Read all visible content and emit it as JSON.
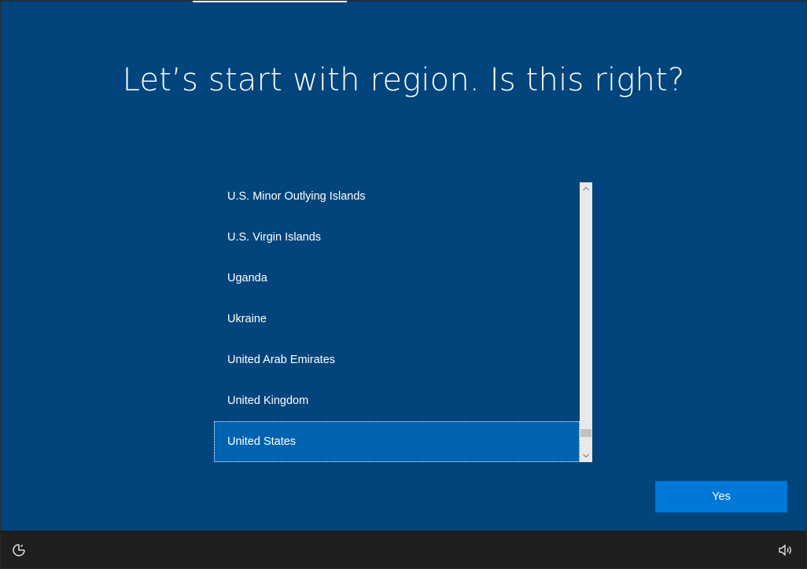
{
  "header": {
    "title": "Let’s start with region. Is this right?"
  },
  "region_list": {
    "items": [
      {
        "label": "U.S. Minor Outlying Islands",
        "selected": false
      },
      {
        "label": "U.S. Virgin Islands",
        "selected": false
      },
      {
        "label": "Uganda",
        "selected": false
      },
      {
        "label": "Ukraine",
        "selected": false
      },
      {
        "label": "United Arab Emirates",
        "selected": false
      },
      {
        "label": "United Kingdom",
        "selected": false
      },
      {
        "label": "United States",
        "selected": true
      }
    ],
    "scrollbar": {
      "up_icon": "chevron-up-icon",
      "down_icon": "chevron-down-icon",
      "scroll_position": 0.93
    }
  },
  "actions": {
    "yes_label": "Yes"
  },
  "bottom_bar": {
    "left_icon": "accessibility-icon",
    "right_icon": "volume-icon"
  },
  "colors": {
    "background": "#01457c",
    "selected_item": "#0063b1",
    "primary_button": "#0078d7",
    "bottom_bar": "#1f1f1f",
    "scrollbar_track": "#e8e8e8"
  }
}
